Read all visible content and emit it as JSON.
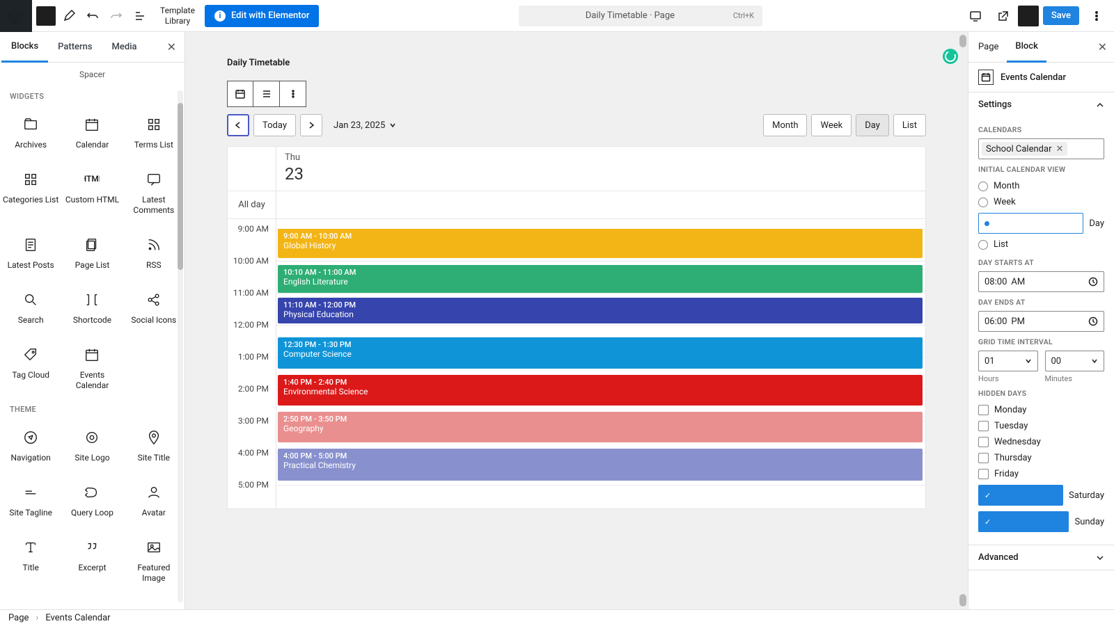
{
  "topbar": {
    "template_library": "Template\nLibrary",
    "elementor_btn": "Edit with Elementor",
    "doc_title": "Daily Timetable · Page",
    "shortcut": "Ctrl+K",
    "save": "Save"
  },
  "left_panel": {
    "tabs": [
      "Blocks",
      "Patterns",
      "Media"
    ],
    "active_tab": 0,
    "spacer_label": "Spacer",
    "sections": [
      {
        "title": "WIDGETS",
        "items": [
          {
            "name": "archives",
            "label": "Archives",
            "icon": "folder"
          },
          {
            "name": "calendar",
            "label": "Calendar",
            "icon": "calendar"
          },
          {
            "name": "terms-list",
            "label": "Terms List",
            "icon": "grid4"
          },
          {
            "name": "categories-list",
            "label": "Categories List",
            "icon": "grid4"
          },
          {
            "name": "custom-html",
            "label": "Custom HTML",
            "icon": "html"
          },
          {
            "name": "latest-comments",
            "label": "Latest Comments",
            "icon": "chat"
          },
          {
            "name": "latest-posts",
            "label": "Latest Posts",
            "icon": "post"
          },
          {
            "name": "page-list",
            "label": "Page List",
            "icon": "pages"
          },
          {
            "name": "rss",
            "label": "RSS",
            "icon": "rss"
          },
          {
            "name": "search",
            "label": "Search",
            "icon": "search"
          },
          {
            "name": "shortcode",
            "label": "Shortcode",
            "icon": "shortcode"
          },
          {
            "name": "social-icons",
            "label": "Social Icons",
            "icon": "share"
          },
          {
            "name": "tag-cloud",
            "label": "Tag Cloud",
            "icon": "tag"
          },
          {
            "name": "events-calendar",
            "label": "Events Calendar",
            "icon": "calendar"
          }
        ]
      },
      {
        "title": "THEME",
        "items": [
          {
            "name": "navigation",
            "label": "Navigation",
            "icon": "compass"
          },
          {
            "name": "site-logo",
            "label": "Site Logo",
            "icon": "hexring"
          },
          {
            "name": "site-title",
            "label": "Site Title",
            "icon": "pin"
          },
          {
            "name": "site-tagline",
            "label": "Site Tagline",
            "icon": "tagline"
          },
          {
            "name": "query-loop",
            "label": "Query Loop",
            "icon": "loop"
          },
          {
            "name": "avatar",
            "label": "Avatar",
            "icon": "avatar"
          },
          {
            "name": "title",
            "label": "Title",
            "icon": "title"
          },
          {
            "name": "excerpt",
            "label": "Excerpt",
            "icon": "quote"
          },
          {
            "name": "featured-image",
            "label": "Featured Image",
            "icon": "image"
          }
        ]
      }
    ]
  },
  "center": {
    "page_title": "Daily Timetable",
    "today": "Today",
    "date_label": "Jan 23, 2025",
    "view_buttons": [
      "Month",
      "Week",
      "Day",
      "List"
    ],
    "active_view": 2,
    "day_of_week": "Thu",
    "day_number": "23",
    "allday_label": "All day",
    "time_labels": [
      "9:00 AM",
      "10:00 AM",
      "11:00 AM",
      "12:00 PM",
      "1:00 PM",
      "2:00 PM",
      "3:00 PM",
      "4:00 PM",
      "5:00 PM"
    ],
    "events": [
      {
        "time": "9:00 AM - 10:00 AM",
        "name": "Global History",
        "color": "#f3b515",
        "top_pct": 0,
        "dur_pct": 11.5
      },
      {
        "time": "10:10 AM - 11:00 AM",
        "name": "English Literature",
        "color": "#2eae74",
        "top_pct": 14,
        "dur_pct": 11
      },
      {
        "time": "11:10 AM - 12:00 PM",
        "name": "Physical Education",
        "color": "#3644ad",
        "top_pct": 27,
        "dur_pct": 10
      },
      {
        "time": "12:30 PM - 1:30 PM",
        "name": "Computer Science",
        "color": "#0f94d8",
        "top_pct": 42.5,
        "dur_pct": 12
      },
      {
        "time": "1:40 PM - 2:40 PM",
        "name": "Environmental Science",
        "color": "#db1919",
        "top_pct": 57,
        "dur_pct": 12
      },
      {
        "time": "2:50 PM - 3:50 PM",
        "name": "Geography",
        "color": "#ea8f8f",
        "top_pct": 71.5,
        "dur_pct": 12
      },
      {
        "time": "4:00 PM - 5:00 PM",
        "name": "Practical Chemistry",
        "color": "#8891ce",
        "top_pct": 86,
        "dur_pct": 12.5
      }
    ]
  },
  "right_panel": {
    "tabs": [
      "Page",
      "Block"
    ],
    "active_tab": 1,
    "block_name": "Events Calendar",
    "settings_label": "Settings",
    "calendars_label": "CALENDARS",
    "calendar_chip": "School Calendar",
    "initial_view_label": "INITIAL CALENDAR VIEW",
    "view_options": [
      "Month",
      "Week",
      "Day",
      "List"
    ],
    "view_selected": 2,
    "day_starts_label": "DAY STARTS AT",
    "day_starts_value": "08:00",
    "day_starts_ampm": "AM",
    "day_ends_label": "DAY ENDS AT",
    "day_ends_value": "06:00",
    "day_ends_ampm": "PM",
    "grid_interval_label": "GRID TIME INTERVAL",
    "hours_value": "01",
    "hours_label": "Hours",
    "minutes_value": "00",
    "minutes_label": "Minutes",
    "hidden_days_label": "HIDDEN DAYS",
    "days": [
      {
        "label": "Monday",
        "checked": false
      },
      {
        "label": "Tuesday",
        "checked": false
      },
      {
        "label": "Wednesday",
        "checked": false
      },
      {
        "label": "Thursday",
        "checked": false
      },
      {
        "label": "Friday",
        "checked": false
      },
      {
        "label": "Saturday",
        "checked": true
      },
      {
        "label": "Sunday",
        "checked": true
      }
    ],
    "advanced_label": "Advanced"
  },
  "breadcrumb": [
    "Page",
    "Events Calendar"
  ]
}
